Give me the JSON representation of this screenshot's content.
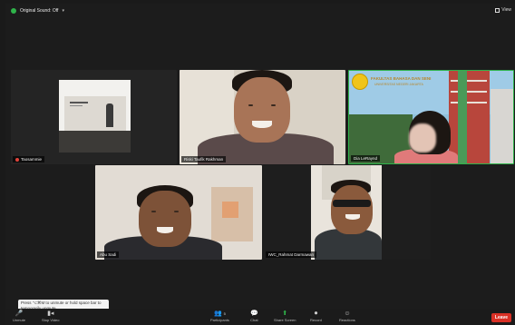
{
  "topbar": {
    "original_sound": "Original Sound: Off",
    "view_label": "View"
  },
  "tiles": [
    {
      "name": "Taosammie"
    },
    {
      "name": "Riski Taufik Rakhman"
    },
    {
      "name": "Dia LeRaynd"
    },
    {
      "name": "Abu Sadi"
    },
    {
      "name": "IWC_Rahmat Darmawan"
    }
  ],
  "banner": {
    "line1": "FAKULTAS BAHASA DAN SENI",
    "line2": "UNIVERSITAS NEGERI JAKARTA"
  },
  "tooltip": "Press ⌥⌘M to unmute or hold space bar to temporarily unmute.",
  "toolbar": {
    "unmute": "Unmute",
    "video": "Stop Video",
    "participants": "Participants",
    "participants_count": "5",
    "chat": "Chat",
    "share": "Share Screen",
    "record": "Record",
    "reactions": "Reactions",
    "leave": "Leave"
  },
  "colors": {
    "leave": "#d93025",
    "green": "#2fb34a",
    "muted": "#e0443b"
  }
}
